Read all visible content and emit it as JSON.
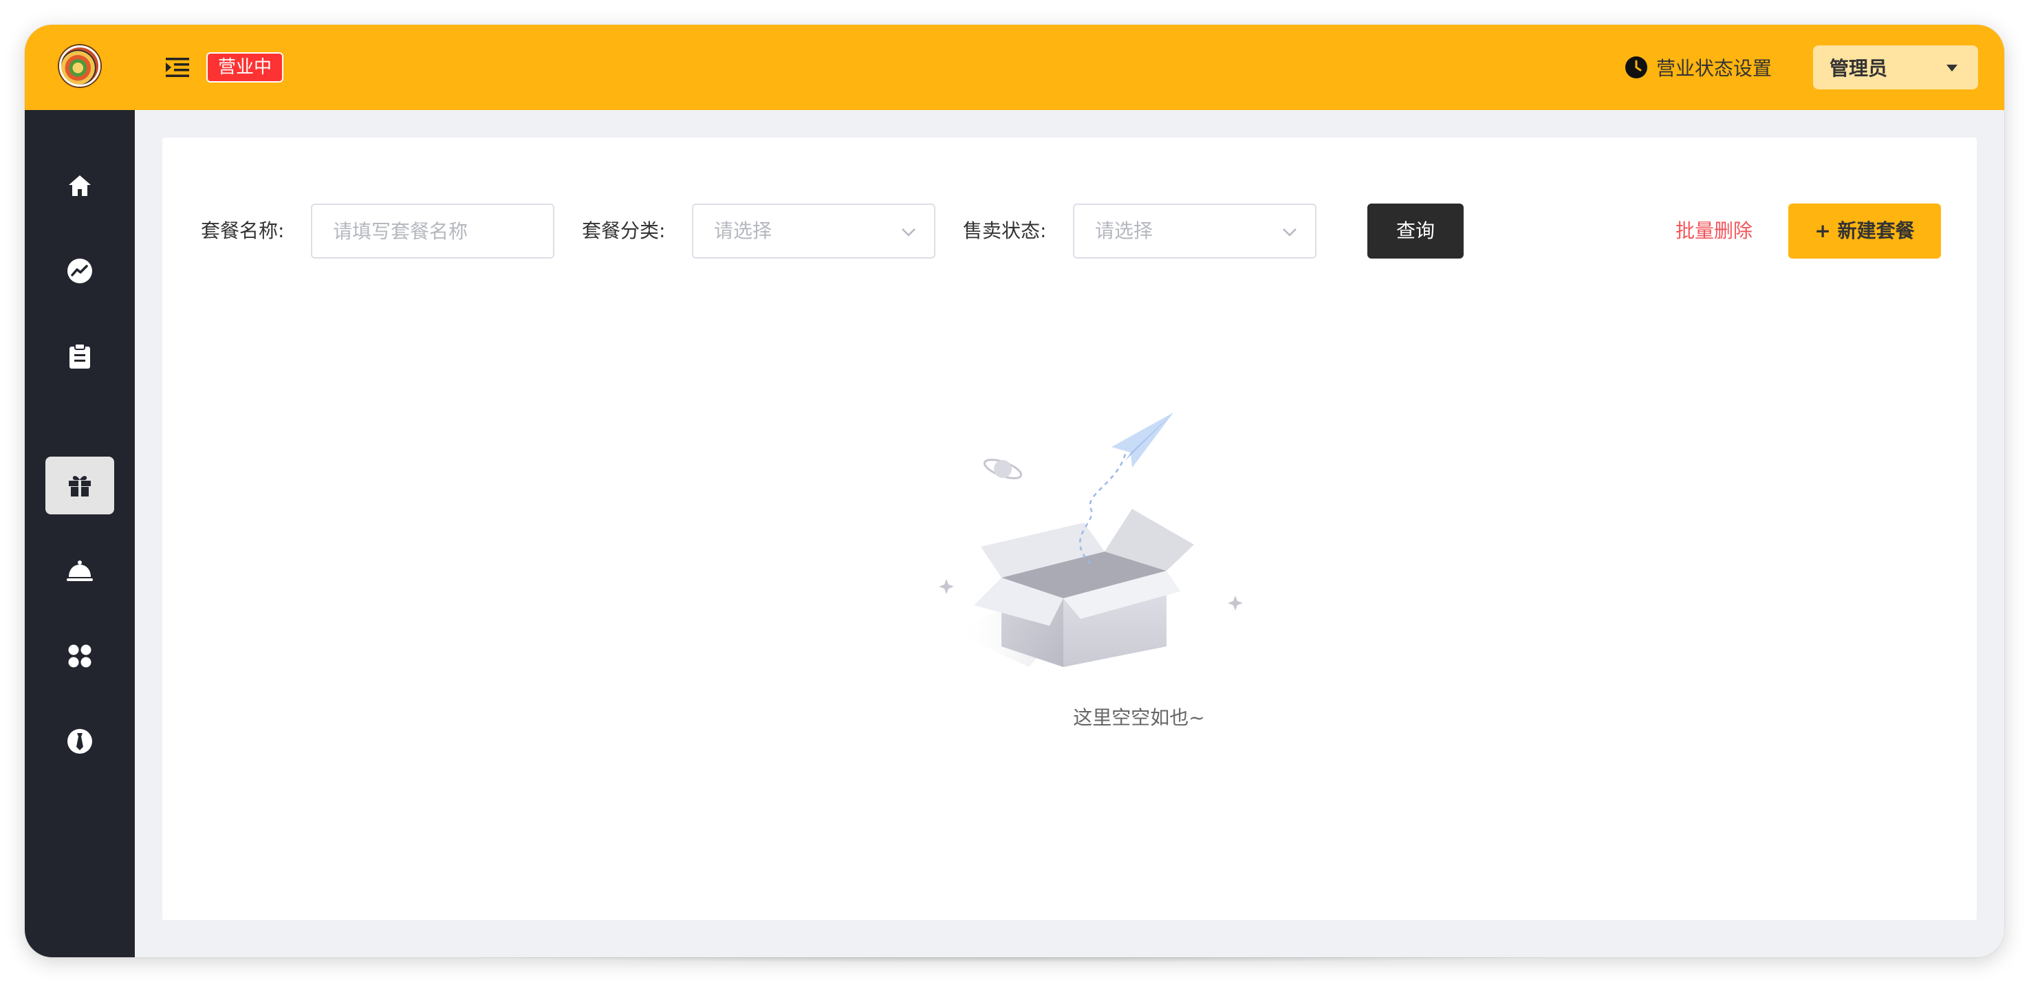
{
  "header": {
    "status_badge": "营业中",
    "status_setting_label": "营业状态设置",
    "admin_name": "管理员"
  },
  "sidebar": {
    "items": [
      {
        "icon": "home-icon",
        "active": false
      },
      {
        "icon": "chart-icon",
        "active": false
      },
      {
        "icon": "clipboard-icon",
        "active": false
      },
      {
        "icon": "gift-icon",
        "active": true
      },
      {
        "icon": "dish-cover-icon",
        "active": false
      },
      {
        "icon": "grid-icon",
        "active": false
      },
      {
        "icon": "user-tie-icon",
        "active": false
      }
    ]
  },
  "filters": {
    "name_label": "套餐名称:",
    "name_placeholder": "请填写套餐名称",
    "category_label": "套餐分类:",
    "category_placeholder": "请选择",
    "status_label": "售卖状态:",
    "status_placeholder": "请选择",
    "query_button": "查询",
    "batch_delete_button": "批量删除",
    "new_button": "+ 新建套餐"
  },
  "empty_state": {
    "text": "这里空空如也~"
  },
  "colors": {
    "brand": "#ffb40f",
    "sidebar": "#22252e",
    "status_badge": "#fd3333",
    "danger_text": "#f2555a",
    "query_button": "#2b2b2b"
  }
}
